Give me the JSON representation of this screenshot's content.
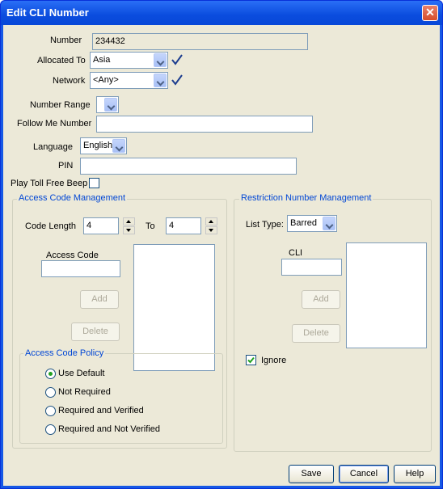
{
  "window": {
    "title": "Edit CLI Number",
    "close_glyph": "✕"
  },
  "form": {
    "number_label": "Number",
    "number_value": "234432",
    "allocated_label": "Allocated To",
    "allocated_value": "Asia",
    "network_label": "Network",
    "network_value": "<Any>",
    "number_range_label": "Number Range",
    "number_range_value": "",
    "follow_me_label": "Follow Me Number",
    "follow_me_value": "",
    "language_label": "Language",
    "language_value": "English",
    "pin_label": "PIN",
    "pin_value": "",
    "play_toll_label": "Play Toll Free Beep",
    "play_toll_checked": false
  },
  "access_code": {
    "title": "Access Code Management",
    "code_length_label": "Code Length",
    "code_length_from": "4",
    "to_label": "To",
    "code_length_to": "4",
    "access_code_label": "Access Code",
    "access_code_value": "",
    "add_label": "Add",
    "delete_label": "Delete",
    "policy": {
      "title": "Access Code Policy",
      "options": [
        "Use Default",
        "Not Required",
        "Required and Verified",
        "Required and Not Verified"
      ],
      "selected": "Use Default"
    }
  },
  "restriction": {
    "title": "Restriction Number Management",
    "list_type_label": "List Type:",
    "list_type_value": "Barred",
    "cli_label": "CLI",
    "cli_value": "",
    "add_label": "Add",
    "delete_label": "Delete",
    "ignore_label": "Ignore",
    "ignore_checked": true
  },
  "buttons": {
    "save": "Save",
    "cancel": "Cancel",
    "help": "Help"
  },
  "colors": {
    "title_bar": "#0a4cde",
    "group_title": "#0046d5",
    "valid_check": "#1c3d8f",
    "radio_dot": "#21a121"
  }
}
